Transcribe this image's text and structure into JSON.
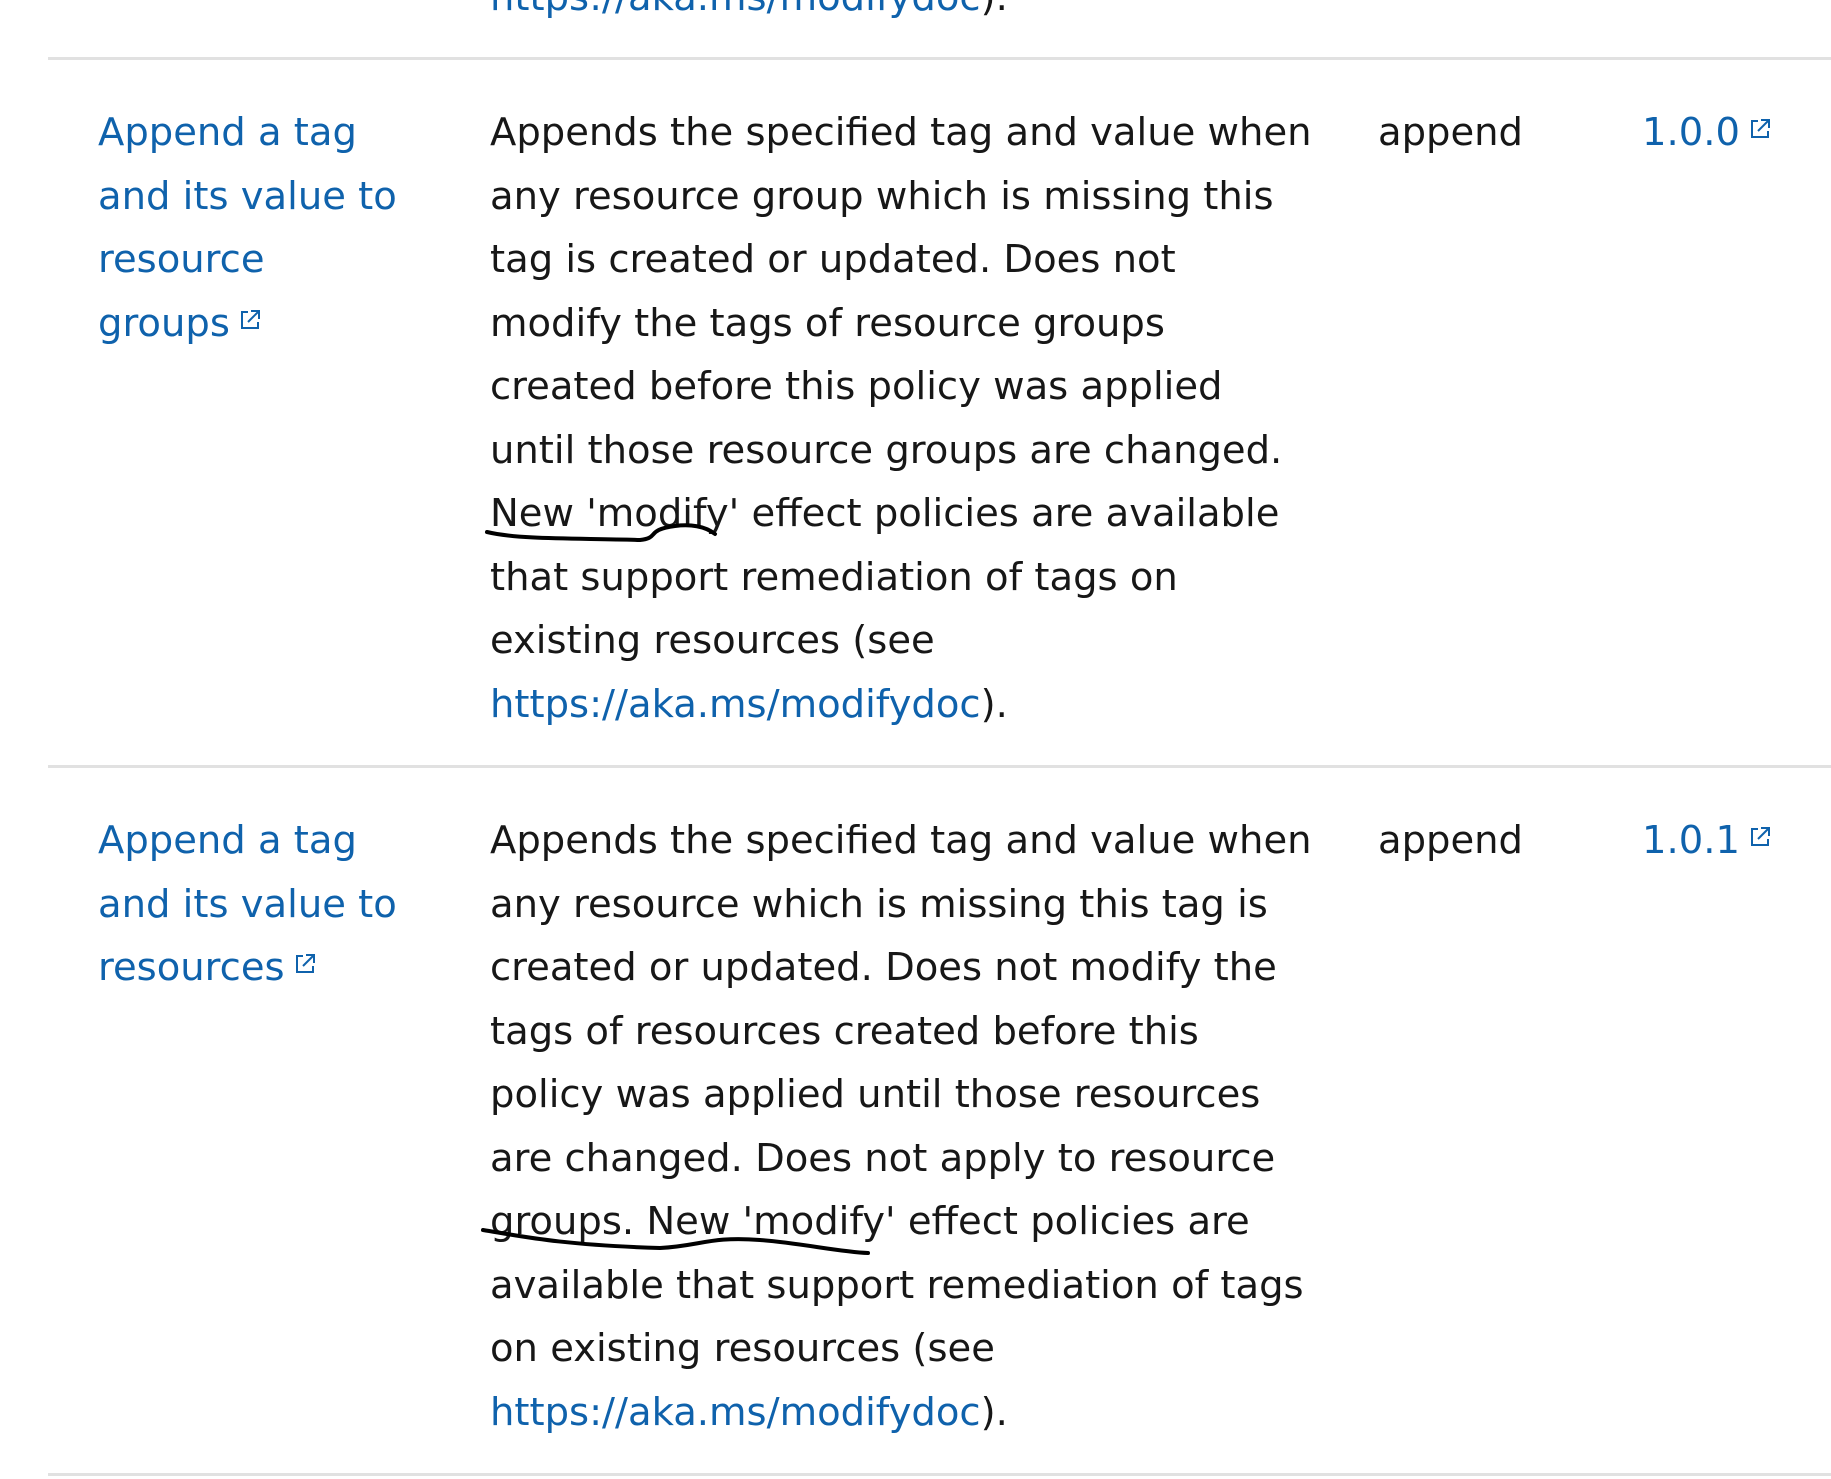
{
  "top_row": {
    "desc_tail_link": "https://aka.ms/modifydoc",
    "desc_tail_after": ")."
  },
  "rows": [
    {
      "name_lines": [
        "Append a tag",
        "and its value to",
        "resource",
        "groups"
      ],
      "description_lines": [
        "Appends the specified tag and value when",
        "any resource group which is missing this",
        "tag is created or updated. Does not",
        "modify the tags of resource groups",
        "created before this policy was applied",
        "until those resource groups are changed.",
        "New 'modify' effect policies are available",
        "that support remediation of tags on",
        "existing resources (see"
      ],
      "doc_link": "https://aka.ms/modifydoc",
      "doc_link_after": ").",
      "effect": "append",
      "version": "1.0.0"
    },
    {
      "name_lines": [
        "Append a tag",
        "and its value to",
        "resources"
      ],
      "description_lines": [
        "Appends the specified tag and value when",
        "any resource which is missing this tag is",
        "created or updated. Does not modify the",
        "tags of resources created before this",
        "policy was applied until those resources",
        "are changed. Does not apply to resource",
        "groups. New 'modify' effect policies are",
        "available that support remediation of tags",
        "on existing resources (see"
      ],
      "doc_link": "https://aka.ms/modifydoc",
      "doc_link_after": ").",
      "effect": "append",
      "version": "1.0.1"
    }
  ],
  "icons": {
    "external_link": "external-link-icon"
  },
  "colors": {
    "link": "#0f62ac",
    "text": "#171717",
    "divider": "#e1e1e1",
    "ink": "#000000"
  }
}
